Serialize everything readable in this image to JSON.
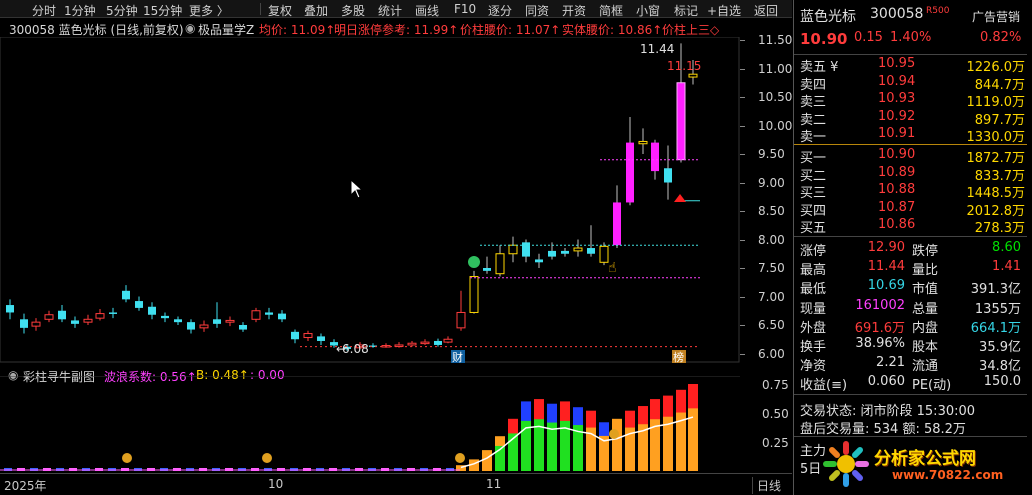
{
  "toolbar": {
    "items": [
      "分时",
      "1分钟",
      "5分钟",
      "15分钟",
      "更多 〉",
      "复权",
      "叠加",
      "多股",
      "统计",
      "画线",
      "F10",
      "逐分",
      "同资",
      "开资",
      "简框",
      "小窗",
      "标记",
      "+自选",
      "返回"
    ]
  },
  "infobar": {
    "code_name": "300058 蓝色光标 (日线,前复权)",
    "indicator": "极品量学Z",
    "avg": "均价: 11.09↑",
    "limit_ref": "明日涨停参考: 11.99↑",
    "waist": "价柱腰价: 11.07↑",
    "body_waist": "实体腰价: 10.86↑",
    "upper": "价柱上三◇"
  },
  "price_axis": {
    "ticks": [
      "11.50",
      "11.00",
      "10.50",
      "10.00",
      "9.50",
      "9.00",
      "8.50",
      "8.00",
      "7.50",
      "7.00",
      "6.50",
      "6.00"
    ]
  },
  "main_chart": {
    "high_label": "11.44",
    "low_label": "6.08",
    "close_label": "11.15",
    "tag_cai": "财",
    "tag_bang": "榜"
  },
  "sub_header": {
    "name": "彩柱寻牛副图",
    "wave": "波浪系数: 0.56↑",
    "b": "B: 0.48↑",
    "zero": ": 0.00"
  },
  "sub_axis": {
    "ticks": [
      "0.75",
      "0.50",
      "0.25"
    ]
  },
  "date_axis": {
    "labels": [
      "2025年",
      "10",
      "11",
      "日线"
    ]
  },
  "right_panel": {
    "name": "蓝色光标",
    "code": "300058",
    "badge": "R500",
    "ad": "广告营销",
    "price": "10.90",
    "change": "0.15",
    "pct": "1.40%",
    "ratio": "0.82%",
    "sell": [
      {
        "label": "卖五 ¥",
        "price": "10.95",
        "vol": "1226.0万"
      },
      {
        "label": "卖四",
        "price": "10.94",
        "vol": "844.7万"
      },
      {
        "label": "卖三",
        "price": "10.93",
        "vol": "1119.0万"
      },
      {
        "label": "卖二",
        "price": "10.92",
        "vol": "897.7万"
      },
      {
        "label": "卖一",
        "price": "10.91",
        "vol": "1330.0万"
      }
    ],
    "buy": [
      {
        "label": "买一",
        "price": "10.90",
        "vol": "1872.7万"
      },
      {
        "label": "买二",
        "price": "10.89",
        "vol": "833.7万"
      },
      {
        "label": "买三",
        "price": "10.88",
        "vol": "1448.5万"
      },
      {
        "label": "买四",
        "price": "10.87",
        "vol": "2012.8万"
      },
      {
        "label": "买五",
        "price": "10.86",
        "vol": "278.3万"
      }
    ],
    "stats": [
      {
        "l1": "涨停",
        "v1": "12.90",
        "c1": "red",
        "l2": "跌停",
        "v2": "8.60",
        "c2": "green"
      },
      {
        "l1": "最高",
        "v1": "11.44",
        "c1": "red",
        "l2": "量比",
        "v2": "1.41",
        "c2": "red"
      },
      {
        "l1": "最低",
        "v1": "10.69",
        "c1": "cyan",
        "l2": "市值",
        "v2": "391.3亿",
        "c2": "white"
      },
      {
        "l1": "现量",
        "v1": "161002",
        "c1": "mag",
        "l2": "总量",
        "v2": "1355万",
        "c2": "white"
      },
      {
        "l1": "外盘",
        "v1": "691.6万",
        "c1": "red",
        "l2": "内盘",
        "v2": "664.1万",
        "c2": "cyan"
      },
      {
        "l1": "换手",
        "v1": "38.96%",
        "c1": "white",
        "l2": "股本",
        "v2": "35.9亿",
        "c2": "white"
      },
      {
        "l1": "净资",
        "v1": "2.21",
        "c1": "white",
        "l2": "流通",
        "v2": "34.8亿",
        "c2": "white"
      },
      {
        "l1": "收益(≡)",
        "v1": "0.060",
        "c1": "white",
        "l2": "PE(动)",
        "v2": "150.0",
        "c2": "white"
      }
    ],
    "trade_state": "交易状态: 闭市阶段 15:30:00",
    "after_trade": "盘后交易量: 534  额: 58.2万",
    "main_label": "主力",
    "day_label": "5日",
    "watermark_title": "分析家公式网",
    "watermark_url": "www.70822.com"
  }
}
